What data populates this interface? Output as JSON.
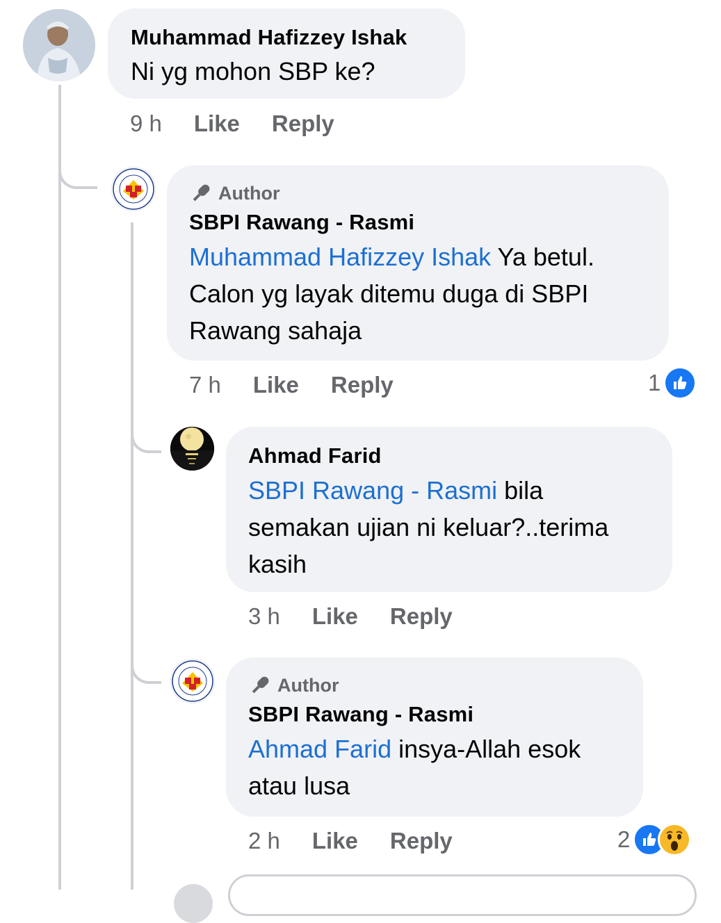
{
  "comments": [
    {
      "name": "Muhammad Hafizzey Ishak",
      "text": "Ni yg mohon SBP ke?",
      "time": "9 h",
      "like_label": "Like",
      "reply_label": "Reply"
    },
    {
      "badge": "Author",
      "name": "SBPI Rawang - Rasmi",
      "mention": "Muhammad Hafizzey Ishak",
      "text": " Ya betul. Calon yg layak ditemu duga di SBPI Rawang sahaja",
      "time": "7 h",
      "like_label": "Like",
      "reply_label": "Reply",
      "reaction_count": "1"
    },
    {
      "name": "Ahmad Farid",
      "mention": "SBPI Rawang - Rasmi",
      "text": " bila semakan ujian ni keluar?..terima kasih",
      "time": "3 h",
      "like_label": "Like",
      "reply_label": "Reply"
    },
    {
      "badge": "Author",
      "name": "SBPI Rawang - Rasmi",
      "mention": "Ahmad Farid",
      "text": " insya-Allah esok atau lusa",
      "time": "2 h",
      "like_label": "Like",
      "reply_label": "Reply",
      "reaction_count": "2"
    }
  ],
  "icons": {
    "author": "mic-icon",
    "reactions": [
      "like-icon",
      "wow-icon"
    ]
  },
  "colors": {
    "mention": "#1d6fd1",
    "bubble": "#f0f2f5",
    "like_blue": "#1877f2"
  }
}
